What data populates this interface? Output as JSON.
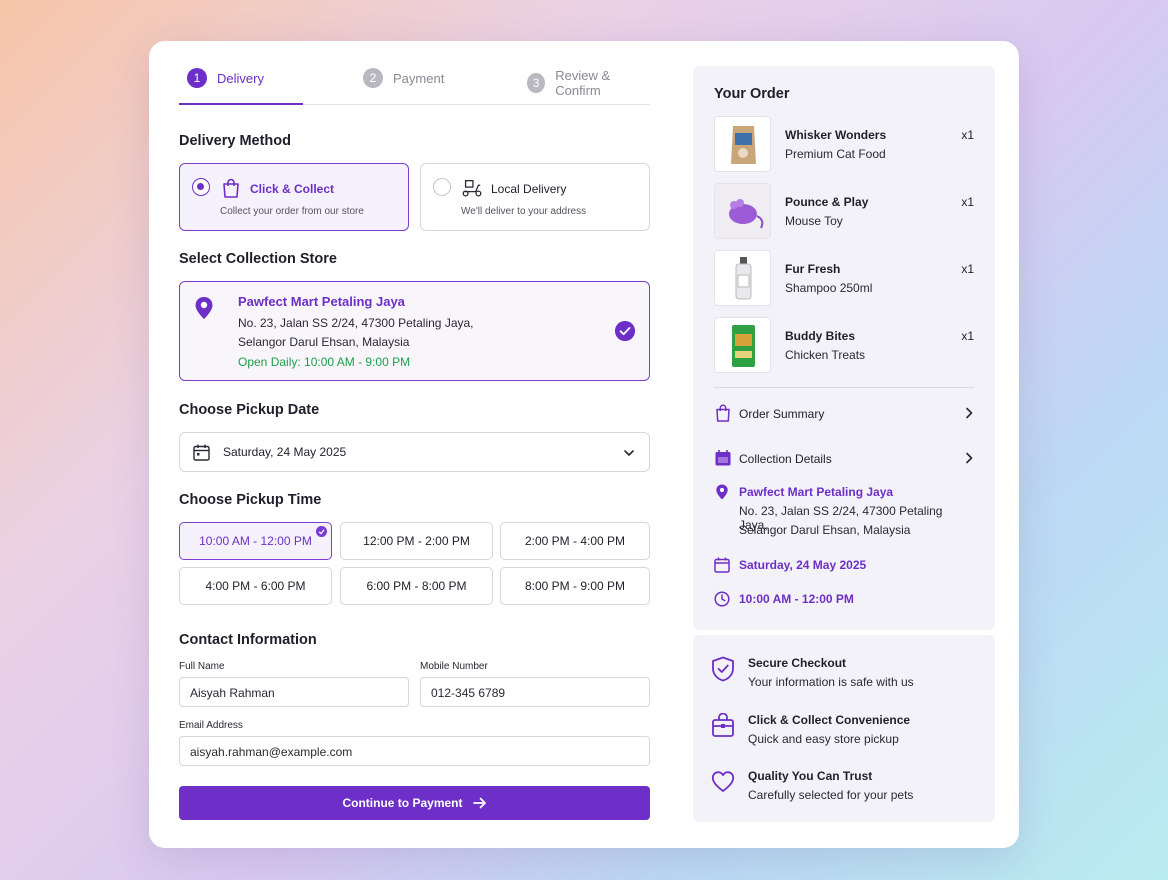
{
  "steps": [
    {
      "num": "1",
      "label": "Delivery",
      "active": true
    },
    {
      "num": "2",
      "label": "Payment",
      "active": false
    },
    {
      "num": "3",
      "label": "Review & Confirm",
      "active": false
    }
  ],
  "delivery_method": {
    "title": "Delivery Method",
    "options": [
      {
        "title": "Click & Collect",
        "desc": "Collect your order from our store",
        "selected": true
      },
      {
        "title": "Local Delivery",
        "desc": "We'll deliver to your address",
        "selected": false
      }
    ]
  },
  "store": {
    "section_title": "Select Collection Store",
    "name": "Pawfect Mart Petaling Jaya",
    "address_line1": "No. 23, Jalan SS 2/24, 47300 Petaling Jaya,",
    "address_line2": "Selangor Darul Ehsan, Malaysia",
    "hours": "Open Daily: 10:00 AM - 9:00 PM"
  },
  "pickup_date": {
    "title": "Choose Pickup Date",
    "value": "Saturday, 24 May 2025"
  },
  "pickup_time": {
    "title": "Choose Pickup Time",
    "slots": [
      {
        "label": "10:00 AM - 12:00 PM",
        "selected": true
      },
      {
        "label": "12:00 PM - 2:00 PM",
        "selected": false
      },
      {
        "label": "2:00 PM - 4:00 PM",
        "selected": false
      },
      {
        "label": "4:00 PM - 6:00 PM",
        "selected": false
      },
      {
        "label": "6:00 PM - 8:00 PM",
        "selected": false
      },
      {
        "label": "8:00 PM - 9:00 PM",
        "selected": false
      }
    ]
  },
  "contact": {
    "title": "Contact Information",
    "full_name_label": "Full Name",
    "full_name_value": "Aisyah Rahman",
    "mobile_label": "Mobile Number",
    "mobile_value": "012-345 6789",
    "email_label": "Email Address",
    "email_value": "aisyah.rahman@example.com"
  },
  "cta_label": "Continue to Payment",
  "order": {
    "title": "Your Order",
    "items": [
      {
        "name": "Whisker Wonders",
        "sub": "Premium Cat Food",
        "qty": "x1",
        "thumb": "cat-food-bag"
      },
      {
        "name": "Pounce & Play",
        "sub": "Mouse Toy",
        "qty": "x1",
        "thumb": "mouse-toy"
      },
      {
        "name": "Fur Fresh",
        "sub": "Shampoo 250ml",
        "qty": "x1",
        "thumb": "shampoo-bottle"
      },
      {
        "name": "Buddy Bites",
        "sub": "Chicken Treats",
        "qty": "x1",
        "thumb": "treat-pack"
      }
    ],
    "order_summary_label": "Order Summary",
    "collection_details_label": "Collection Details",
    "cd_store_name": "Pawfect Mart Petaling Jaya",
    "cd_addr1": "No. 23, Jalan SS 2/24, 47300 Petaling Jaya,",
    "cd_addr2": "Selangor Darul Ehsan, Malaysia",
    "cd_date": "Saturday, 24 May 2025",
    "cd_time": "10:00 AM - 12:00 PM"
  },
  "trust": [
    {
      "title": "Secure Checkout",
      "sub": "Your information is safe with us",
      "icon": "shield-check-icon"
    },
    {
      "title": "Click & Collect Convenience",
      "sub": "Quick and easy store pickup",
      "icon": "store-box-icon"
    },
    {
      "title": "Quality You Can Trust",
      "sub": "Carefully selected for your pets",
      "icon": "heart-icon"
    }
  ],
  "colors": {
    "accent": "#6d2fc7",
    "success": "#1e9e4a"
  }
}
